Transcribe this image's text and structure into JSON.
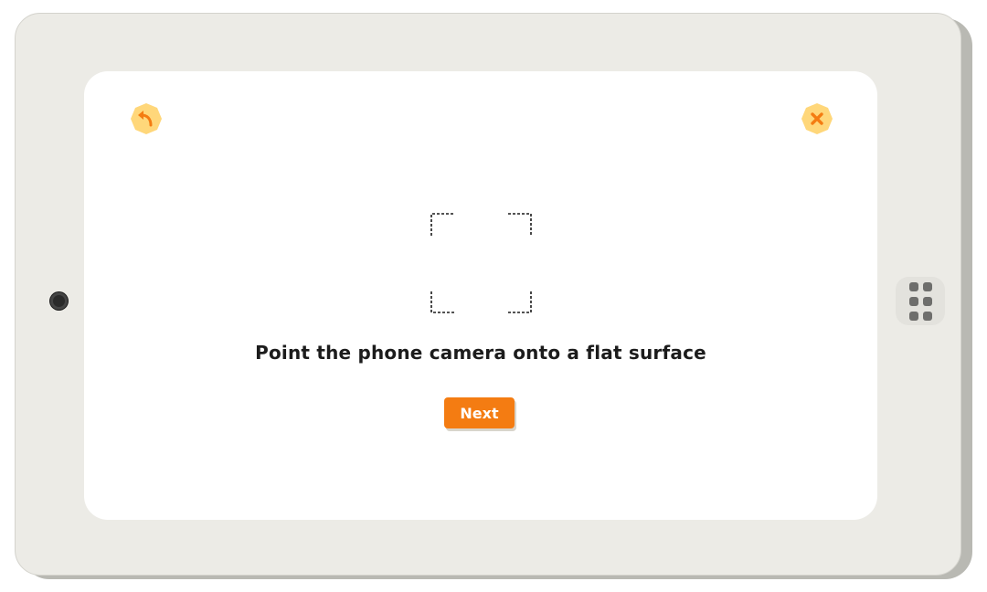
{
  "screen": {
    "prompt_text": "Point the phone camera onto a flat surface",
    "next_label": "Next"
  },
  "icons": {
    "back": "undo-arrow-icon",
    "close": "close-x-icon",
    "scan_frame": "scan-frame-icon",
    "home": "app-grid-icon",
    "camera": "front-camera-icon"
  },
  "colors": {
    "accent": "#f47c12",
    "icon_badge_bg": "#ffd77a",
    "device_body": "#ecebe6",
    "screen_bg": "#ffffff",
    "text": "#1c1c1c"
  }
}
